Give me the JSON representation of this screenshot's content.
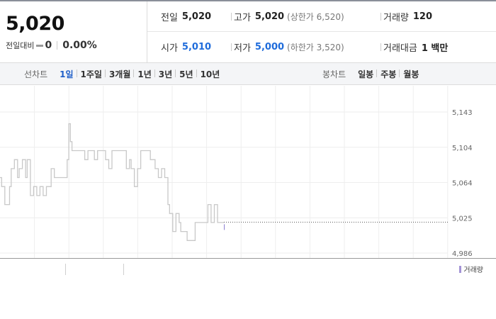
{
  "quote": {
    "price": "5,020",
    "diff_label": "전일대비",
    "diff_value": "0",
    "diff_rate": "0.00%"
  },
  "info": {
    "prev_close": {
      "label": "전일",
      "value": "5,020"
    },
    "open": {
      "label": "시가",
      "value": "5,010",
      "color": "#1f6cdb"
    },
    "high": {
      "label": "고가",
      "value": "5,020",
      "note": "(상한가 6,520)"
    },
    "low": {
      "label": "저가",
      "value": "5,000",
      "color": "#1f6cdb",
      "note": "(하한가 3,520)"
    },
    "volume": {
      "label": "거래량",
      "value": "120"
    },
    "amount": {
      "label": "거래대금",
      "value": "1 백만"
    }
  },
  "tabs": {
    "line_label": "선차트",
    "line_items": [
      "1일",
      "1주일",
      "3개월",
      "1년",
      "3년",
      "5년",
      "10년"
    ],
    "active": "1일",
    "candle_label": "봉차트",
    "candle_items": [
      "일봉",
      "주봉",
      "월봉"
    ]
  },
  "chart_data": {
    "type": "line",
    "y_ticks": [
      "5,143",
      "5,104",
      "5,064",
      "5,025",
      "4,986"
    ],
    "ylim": [
      4986,
      5143
    ],
    "reference_price": 5020,
    "series": [
      {
        "values": [
          5070,
          5060,
          5060,
          5040,
          5040,
          5040,
          5060,
          5080,
          5080,
          5090,
          5090,
          5070,
          5080,
          5080,
          5090,
          5090,
          5070,
          5090,
          5090,
          5050,
          5050,
          5060,
          5060,
          5050,
          5050,
          5060,
          5060,
          5050,
          5050,
          5060,
          5060,
          5060,
          5080,
          5080,
          5070,
          5070,
          5070,
          5070,
          5070,
          5070,
          5070,
          5070,
          5090,
          5130,
          5110,
          5100,
          5100,
          5100,
          5100,
          5100,
          5100,
          5100,
          5100,
          5090,
          5090,
          5100,
          5100,
          5100,
          5100,
          5090,
          5090,
          5100,
          5100,
          5100,
          5100,
          5100,
          5090,
          5090,
          5080,
          5080,
          5100,
          5100,
          5100,
          5100,
          5100,
          5100,
          5100,
          5100,
          5100,
          5080,
          5080,
          5090,
          5080,
          5080,
          5060,
          5060,
          5080,
          5080,
          5100,
          5100,
          5100,
          5100,
          5100,
          5100,
          5090,
          5090,
          5090,
          5080,
          5080,
          5070,
          5070,
          5080,
          5080,
          5070,
          5070,
          5040,
          5030,
          5030,
          5010,
          5010,
          5030,
          5030,
          5020,
          5010,
          5010,
          5010,
          5010,
          5000,
          5000,
          5000,
          5000,
          5000,
          5020,
          5020,
          5020,
          5020,
          5020,
          5020,
          5020,
          5020,
          5040,
          5040,
          5020,
          5020,
          5040,
          5040,
          5020,
          5020,
          5020,
          5020,
          5020
        ],
        "color": "#c8c8c8"
      }
    ],
    "volume_legend": "거래량",
    "grid": true
  }
}
